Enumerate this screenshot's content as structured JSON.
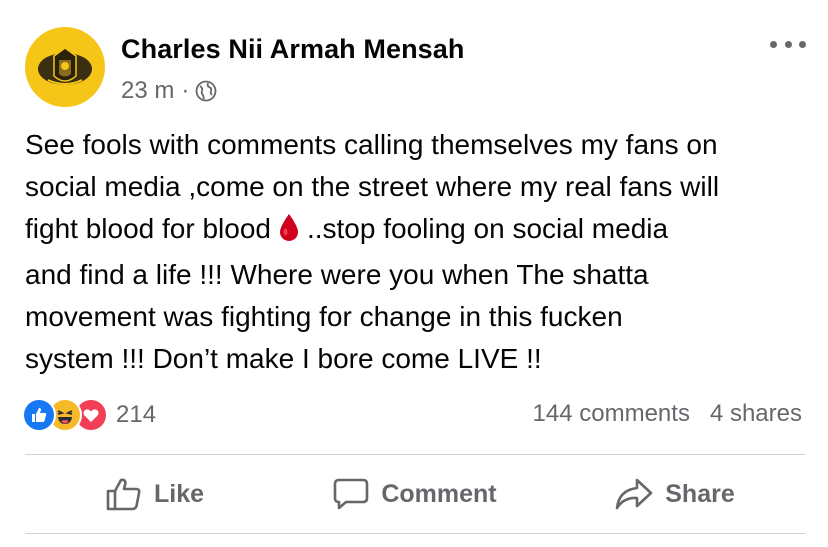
{
  "post": {
    "author": "Charles Nii Armah Mensah",
    "time": "23 m",
    "separator": "·",
    "privacy_icon": "globe-icon",
    "more_icon": "more-options-icon",
    "body_lines": [
      "See fools with comments calling themselves my fans on",
      "social media ,come on the street where my real fans will",
      "fight blood for blood",
      "..stop fooling on social media",
      "and find a life !!! Where were you when The shatta",
      "movement was fighting for change in this fucken",
      "system !!! Don’t make I bore come LIVE !!"
    ],
    "emoji_icon": "blood-drop-icon"
  },
  "reactions": {
    "icons": [
      "like-reaction-icon",
      "haha-reaction-icon",
      "love-reaction-icon"
    ],
    "count": "214",
    "comments": "144 comments",
    "shares": "4 shares"
  },
  "actions": {
    "like": "Like",
    "comment": "Comment",
    "share": "Share"
  },
  "colors": {
    "text": "#050505",
    "secondary": "#65676b",
    "like_blue": "#1877f2",
    "haha_yellow": "#f7b928",
    "love_red": "#f33e58",
    "avatar_bg": "#f5c518",
    "blood_red": "#d0021b"
  }
}
